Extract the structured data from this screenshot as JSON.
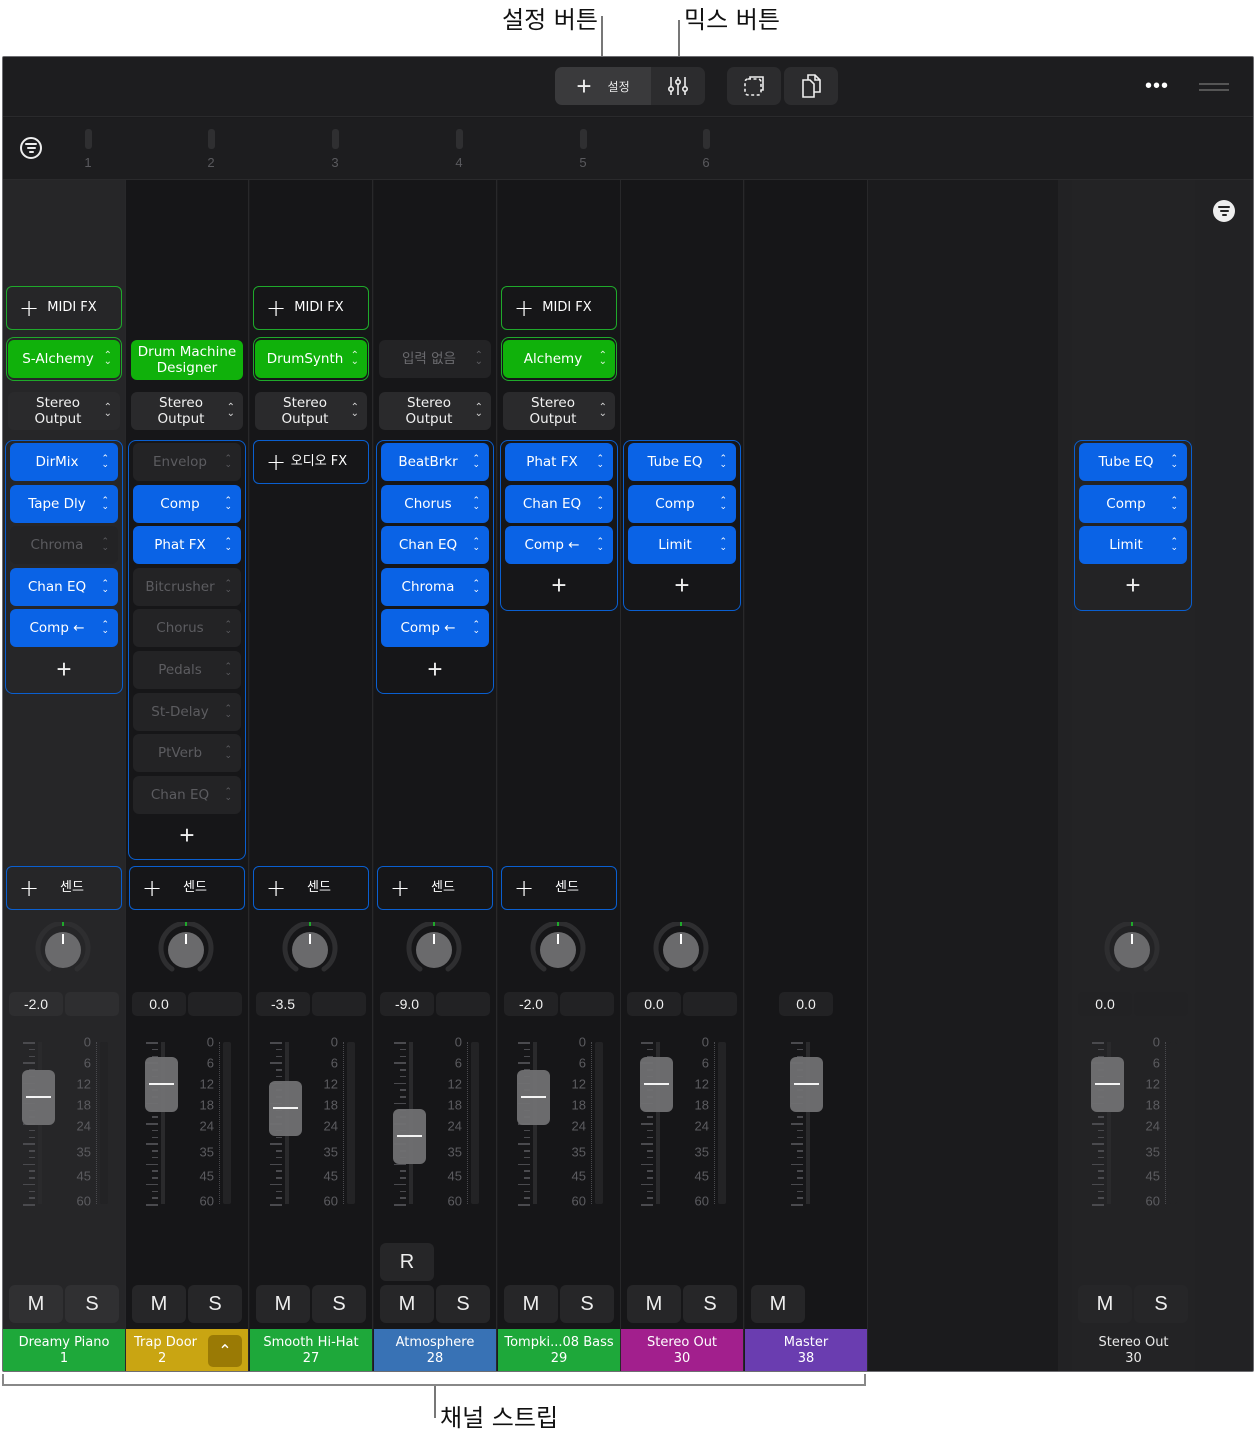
{
  "callouts": {
    "settings_button": "설정 버튼",
    "mix_button": "믹스 버튼",
    "channel_strips": "채널 스트립"
  },
  "toolbar": {
    "settings_label": "설정",
    "settings_icon": "plus-icon",
    "mix_icon": "sliders-icon",
    "select_icon": "dashed-select-icon",
    "copy_icon": "copy-docs-icon",
    "more_label": "•••",
    "handle_icon": "drag-handle-icon"
  },
  "ruler": {
    "numbers": [
      "1",
      "2",
      "3",
      "4",
      "5",
      "6"
    ]
  },
  "colors": {
    "instrument_green": "#10b10b",
    "fx_blue": "#0a63e6",
    "dreamy_piano": "#1ea83a",
    "trap_door": "#c9a512",
    "smooth_hihat": "#1ea83a",
    "atmosphere": "#3872b5",
    "tompkins_bass": "#1ea83a",
    "stereo_out": "#a21f8d",
    "master": "#6a3db0"
  },
  "labels": {
    "midi_fx": "MIDI FX",
    "audio_fx": "오디오 FX",
    "send": "센드",
    "plus": "+",
    "arrow_updown": "⌃⌄",
    "mute": "M",
    "solo": "S",
    "record": "R"
  },
  "strips": [
    {
      "name": "Dreamy Piano",
      "number": "1",
      "color": "#1ea83a",
      "instrument": "S-Alchemy",
      "io": "Stereo Output",
      "fx": [
        {
          "label": "DirMix",
          "on": true
        },
        {
          "label": "Tape Dly",
          "on": true
        },
        {
          "label": "Chroma",
          "on": false
        },
        {
          "label": "Chan EQ",
          "on": true
        },
        {
          "label": "Comp ←",
          "on": true
        }
      ],
      "pan_value": "-2.0",
      "fader_db": -2.0,
      "fader_pos": 0.34
    },
    {
      "name": "Trap Door",
      "number": "2",
      "color": "#c9a512",
      "instrument": "Drum Machine Designer",
      "io": "Stereo Output",
      "fx": [
        {
          "label": "Envelop",
          "on": false
        },
        {
          "label": "Comp",
          "on": true
        },
        {
          "label": "Phat FX",
          "on": true
        },
        {
          "label": "Bitcrusher",
          "on": false
        },
        {
          "label": "Chorus",
          "on": false
        },
        {
          "label": "Pedals",
          "on": false
        },
        {
          "label": "St-Delay",
          "on": false
        },
        {
          "label": "PtVerb",
          "on": false
        },
        {
          "label": "Chan EQ",
          "on": false
        }
      ],
      "pan_value": "0.0",
      "fader_db": 0.0,
      "fader_pos": 0.26
    },
    {
      "name": "Smooth Hi-Hat",
      "number": "27",
      "color": "#1ea83a",
      "instrument": "DrumSynth",
      "io": "Stereo Output",
      "fx": [],
      "pan_value": "-3.5",
      "fader_db": -3.5,
      "fader_pos": 0.41
    },
    {
      "name": "Atmosphere",
      "number": "28",
      "color": "#3872b5",
      "instrument": "입력 없음",
      "io": "Stereo Output",
      "fx": [
        {
          "label": "BeatBrkr",
          "on": true
        },
        {
          "label": "Chorus",
          "on": true
        },
        {
          "label": "Chan EQ",
          "on": true
        },
        {
          "label": "Chroma",
          "on": true
        },
        {
          "label": "Comp ←",
          "on": true
        }
      ],
      "pan_value": "-9.0",
      "fader_db": -9.0,
      "fader_pos": 0.58
    },
    {
      "name": "Tompki...08 Bass",
      "number": "29",
      "color": "#1ea83a",
      "instrument": "Alchemy",
      "io": "Stereo Output",
      "fx": [
        {
          "label": "Phat FX",
          "on": true
        },
        {
          "label": "Chan EQ",
          "on": true
        },
        {
          "label": "Comp ←",
          "on": true
        }
      ],
      "pan_value": "-2.0",
      "fader_db": -2.0,
      "fader_pos": 0.34
    },
    {
      "name": "Stereo Out",
      "number": "30",
      "color": "#a21f8d",
      "fx": [
        {
          "label": "Tube EQ",
          "on": true
        },
        {
          "label": "Comp",
          "on": true
        },
        {
          "label": "Limit",
          "on": true
        }
      ],
      "pan_value": "0.0",
      "fader_db": 0.0,
      "fader_pos": 0.26
    },
    {
      "name": "Master",
      "number": "38",
      "color": "#6a3db0",
      "pan_value": "0.0",
      "fader_db": 0.0,
      "fader_pos": 0.26
    }
  ],
  "output_strip": {
    "name": "Stereo Out",
    "number": "30",
    "fx": [
      {
        "label": "Tube EQ",
        "on": true
      },
      {
        "label": "Comp",
        "on": true
      },
      {
        "label": "Limit",
        "on": true
      }
    ],
    "pan_value": "0.0",
    "fader_db": 0.0,
    "fader_pos": 0.26
  },
  "meter_scale": [
    "0",
    "6",
    "12",
    "18",
    "24",
    "35",
    "45",
    "60"
  ]
}
